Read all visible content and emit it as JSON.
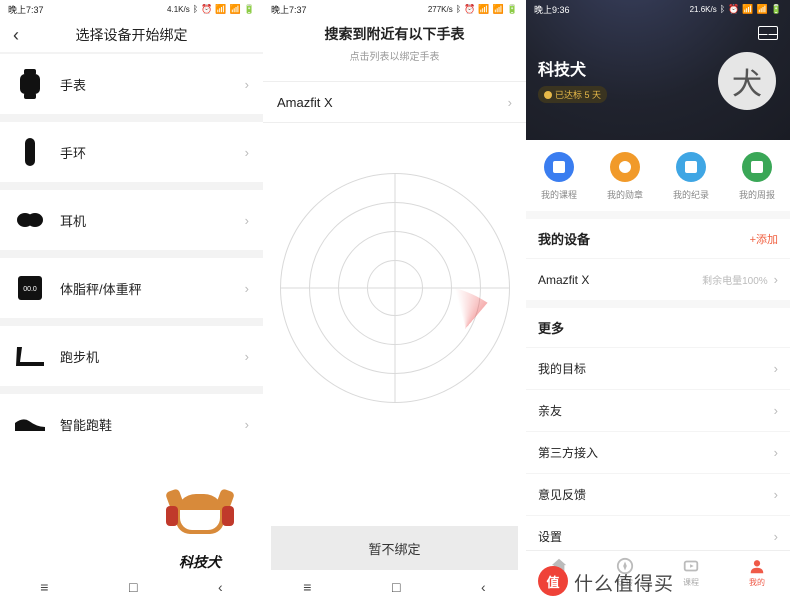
{
  "screens": {
    "s1": {
      "status": {
        "time": "晚上7:37",
        "net": "4.1K/s"
      },
      "title": "选择设备开始绑定",
      "categories": [
        {
          "label": "手表",
          "icon": "watch-icon"
        },
        {
          "label": "手环",
          "icon": "band-icon"
        },
        {
          "label": "耳机",
          "icon": "earbuds-icon"
        },
        {
          "label": "体脂秤/体重秤",
          "icon": "scale-icon"
        },
        {
          "label": "跑步机",
          "icon": "treadmill-icon"
        },
        {
          "label": "智能跑鞋",
          "icon": "shoe-icon"
        }
      ],
      "mascot_text": "科技犬"
    },
    "s2": {
      "status": {
        "time": "晚上7:37",
        "net": "277K/s"
      },
      "title": "搜索到附近有以下手表",
      "subtitle": "点击列表以绑定手表",
      "found_device": "Amazfit X",
      "skip_button": "暂不绑定"
    },
    "s3": {
      "status": {
        "time": "晚上9:36",
        "net": "21.6K/s"
      },
      "username": "科技犬",
      "streak_tag": "已达标 5 天",
      "avatar_glyph": "犬",
      "quick": [
        {
          "label": "我的课程",
          "color": "blue"
        },
        {
          "label": "我的勋章",
          "color": "orange"
        },
        {
          "label": "我的纪录",
          "color": "cyan"
        },
        {
          "label": "我的周报",
          "color": "green"
        }
      ],
      "devices": {
        "section_title": "我的设备",
        "add_label": "+添加",
        "items": [
          {
            "name": "Amazfit X",
            "battery_text": "剩余电量100%"
          }
        ]
      },
      "more": {
        "section_title": "更多",
        "items": [
          {
            "label": "我的目标"
          },
          {
            "label": "亲友"
          },
          {
            "label": "第三方接入"
          },
          {
            "label": "意见反馈"
          },
          {
            "label": "设置"
          }
        ]
      },
      "tabs": [
        {
          "label": "首页"
        },
        {
          "label": "玩转"
        },
        {
          "label": "课程"
        },
        {
          "label": "我的",
          "active": true
        }
      ]
    }
  },
  "watermark": {
    "badge": "值",
    "text": "什么值得买"
  }
}
